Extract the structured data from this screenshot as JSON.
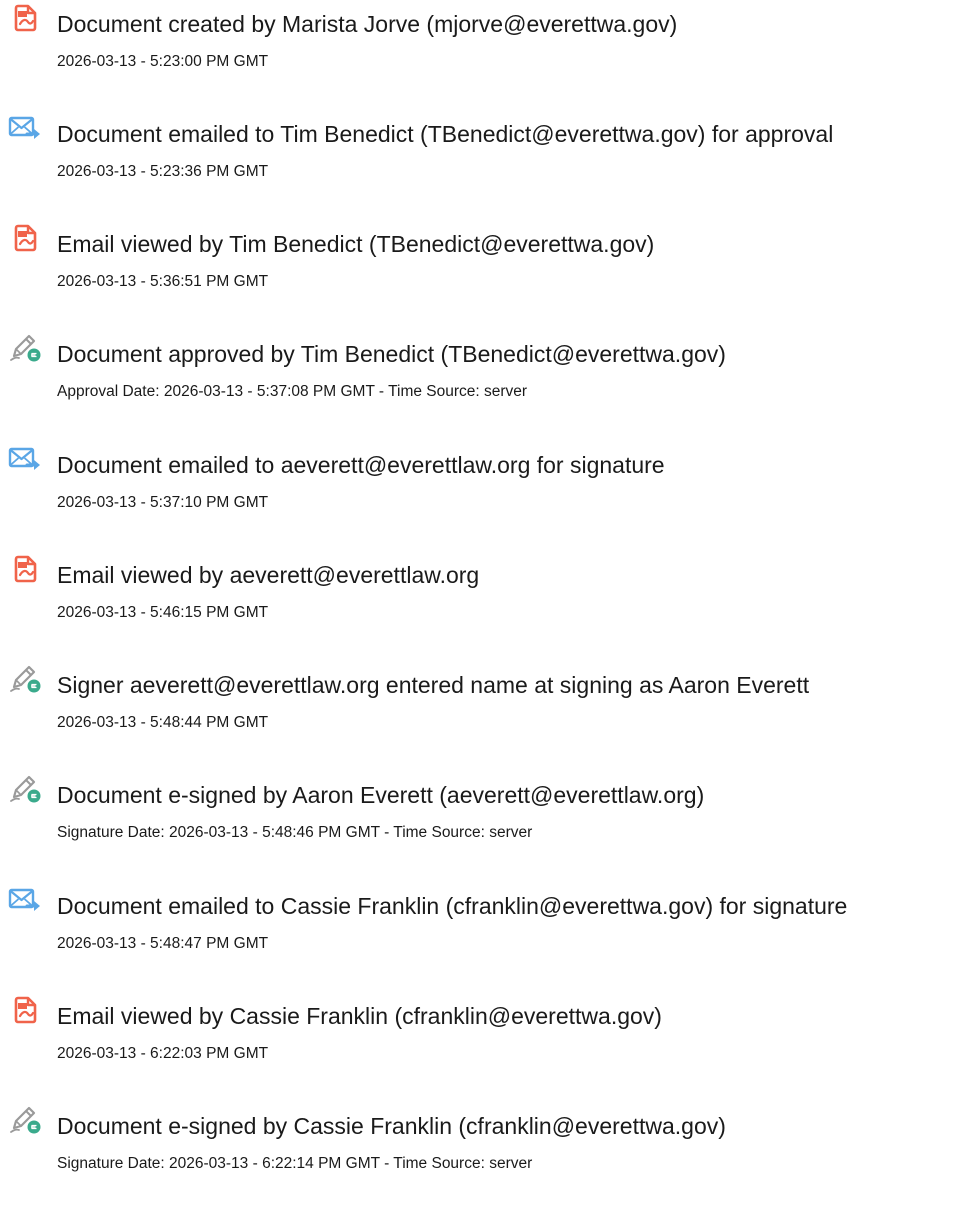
{
  "entries": [
    {
      "icon": "document-icon",
      "title": "Document created by Marista Jorve (mjorve@everettwa.gov)",
      "meta": "2026-03-13 - 5:23:00 PM GMT"
    },
    {
      "icon": "email-icon",
      "title": "Document emailed to Tim Benedict (TBenedict@everettwa.gov) for approval",
      "meta": "2026-03-13 - 5:23:36 PM GMT"
    },
    {
      "icon": "document-icon",
      "title": "Email viewed by Tim Benedict (TBenedict@everettwa.gov)",
      "meta": "2026-03-13 - 5:36:51 PM GMT"
    },
    {
      "icon": "esign-pen-icon",
      "title": "Document approved by Tim Benedict (TBenedict@everettwa.gov)",
      "meta": "Approval Date: 2026-03-13 - 5:37:08 PM GMT - Time Source: server"
    },
    {
      "icon": "email-icon",
      "title": "Document emailed to aeverett@everettlaw.org for signature",
      "meta": "2026-03-13 - 5:37:10 PM GMT"
    },
    {
      "icon": "document-icon",
      "title": "Email viewed by aeverett@everettlaw.org",
      "meta": "2026-03-13 - 5:46:15 PM GMT"
    },
    {
      "icon": "esign-pen-icon",
      "title": "Signer aeverett@everettlaw.org entered name at signing as Aaron Everett",
      "meta": "2026-03-13 - 5:48:44 PM GMT"
    },
    {
      "icon": "esign-pen-icon",
      "title": "Document e-signed by Aaron Everett (aeverett@everettlaw.org)",
      "meta": "Signature Date: 2026-03-13 - 5:48:46 PM GMT - Time Source: server"
    },
    {
      "icon": "email-icon",
      "title": "Document emailed to Cassie Franklin (cfranklin@everettwa.gov) for signature",
      "meta": "2026-03-13 - 5:48:47 PM GMT"
    },
    {
      "icon": "document-icon",
      "title": "Email viewed by Cassie Franklin (cfranklin@everettwa.gov)",
      "meta": "2026-03-13 - 6:22:03 PM GMT"
    },
    {
      "icon": "esign-pen-icon",
      "title": "Document e-signed by Cassie Franklin (cfranklin@everettwa.gov)",
      "meta": "Signature Date: 2026-03-13 - 6:22:14 PM GMT - Time Source: server"
    }
  ],
  "colors": {
    "document_icon": "#f0634a",
    "email_icon": "#5aa6e6",
    "esign_pen_icon": "#9a9a9a",
    "esign_badge": "#3aaa8c",
    "text": "#1a1a1a"
  }
}
